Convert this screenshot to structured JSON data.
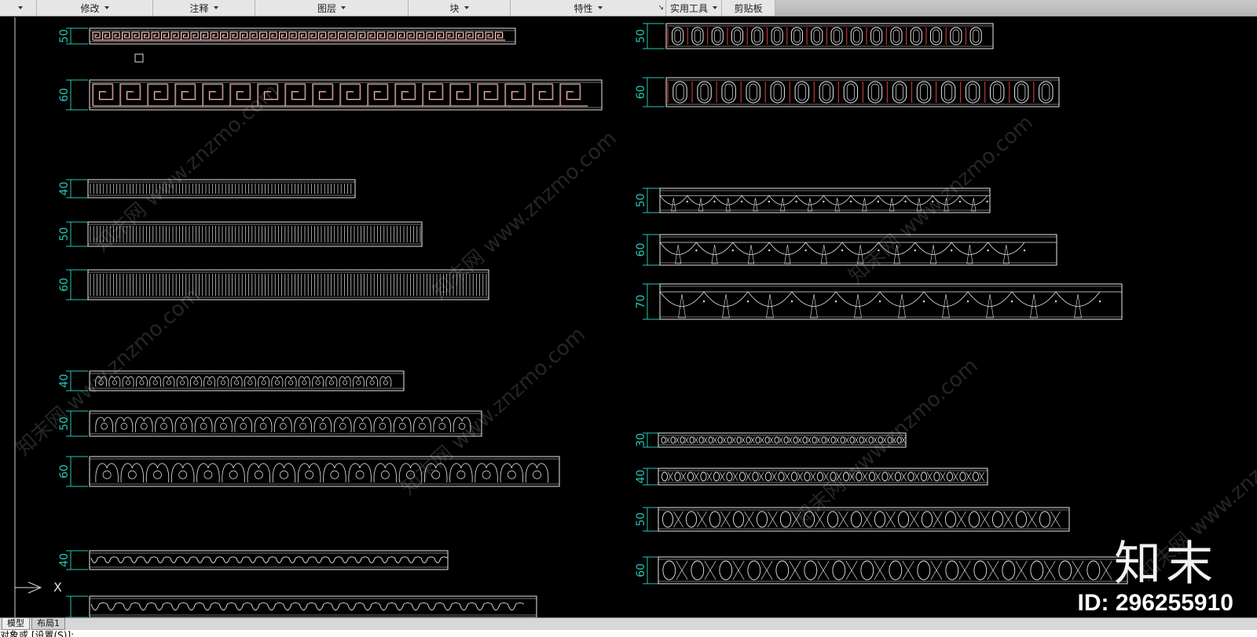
{
  "ribbon": {
    "panels": [
      {
        "label": "",
        "has_caret": true
      },
      {
        "label": "修改",
        "has_caret": true
      },
      {
        "label": "注释",
        "has_caret": true
      },
      {
        "label": "图层",
        "has_caret": true
      },
      {
        "label": "块",
        "has_caret": true
      },
      {
        "label": "特性",
        "has_caret": true
      },
      {
        "label": "实用工具",
        "has_caret": true
      },
      {
        "label": "剪贴板",
        "has_caret": false
      }
    ],
    "expander_glyph": "↘"
  },
  "layout_tabs": {
    "model": "模型",
    "layout1": "布局1"
  },
  "command_line": {
    "text": "对象或 [设置(S)]:"
  },
  "brand": {
    "name": "知末",
    "id_text": "ID: 296255910"
  },
  "watermark": {
    "text": "www.znzmo.com",
    "prefix": "知末网"
  },
  "ucs": {
    "x_label": "X"
  },
  "colors": {
    "background": "#000000",
    "lines": "#e8e8e8",
    "dims": "#26c6b8",
    "pattern_red": "#c0392b"
  },
  "drawing": {
    "left_column": [
      {
        "dim": "50",
        "pattern": "greek-key",
        "fill": "red"
      },
      {
        "dim": "60",
        "pattern": "greek-key",
        "fill": "red"
      },
      {
        "dim": "40",
        "pattern": "flutes"
      },
      {
        "dim": "50",
        "pattern": "flutes"
      },
      {
        "dim": "60",
        "pattern": "flutes"
      },
      {
        "dim": "40",
        "pattern": "acanthus"
      },
      {
        "dim": "50",
        "pattern": "acanthus"
      },
      {
        "dim": "60",
        "pattern": "acanthus"
      },
      {
        "dim": "40",
        "pattern": "waves"
      },
      {
        "dim": "",
        "pattern": "waves"
      }
    ],
    "right_column": [
      {
        "dim": "50",
        "pattern": "egg-dart",
        "fill": "red"
      },
      {
        "dim": "60",
        "pattern": "egg-dart",
        "fill": "red"
      },
      {
        "dim": "50",
        "pattern": "scallop"
      },
      {
        "dim": "60",
        "pattern": "scallop"
      },
      {
        "dim": "70",
        "pattern": "scallop"
      },
      {
        "dim": "30",
        "pattern": "bead-reel"
      },
      {
        "dim": "40",
        "pattern": "bead-reel"
      },
      {
        "dim": "50",
        "pattern": "bead-reel"
      },
      {
        "dim": "60",
        "pattern": "bead-reel"
      }
    ]
  }
}
